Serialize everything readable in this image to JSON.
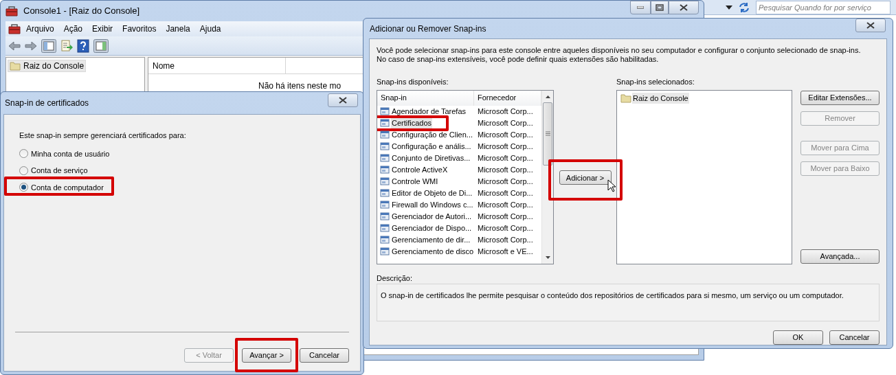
{
  "browser_bar": {
    "search": {
      "placeholder": "Pesquisar Quando for por serviço"
    }
  },
  "console": {
    "title": "Console1 - [Raiz do Console]",
    "menu": [
      "Arquivo",
      "Ação",
      "Exibir",
      "Favoritos",
      "Janela",
      "Ajuda"
    ],
    "tree": [
      {
        "label": "Raiz do Console",
        "selected": true
      }
    ],
    "list": {
      "columns": [
        "Nome"
      ],
      "empty_message": "Não há itens neste mo"
    }
  },
  "certificate_dialog": {
    "title": "Snap-in de certificados",
    "prompt": "Este snap-in sempre gerenciará certificados para:",
    "options": [
      {
        "label": "Minha conta de usuário",
        "selected": false,
        "highlighted": false
      },
      {
        "label": "Conta de serviço",
        "selected": false,
        "highlighted": false
      },
      {
        "label": "Conta de computador",
        "selected": true,
        "highlighted": true
      }
    ],
    "buttons": [
      {
        "label": "< Voltar",
        "disabled": true,
        "highlighted": false
      },
      {
        "label": "Avançar >",
        "disabled": false,
        "highlighted": true
      },
      {
        "label": "Cancelar",
        "disabled": false,
        "highlighted": false
      }
    ]
  },
  "snapin_dialog": {
    "title": "Adicionar ou Remover Snap-ins",
    "intro": [
      "Você pode selecionar snap-ins para este console entre aqueles disponíveis no seu computador e configurar o conjunto selecionado de snap-ins.",
      "No caso de snap-ins extensíveis, você pode definir quais extensões são habilitadas."
    ],
    "available_label": "Snap-ins disponíveis:",
    "columns": [
      "Snap-in",
      "Fornecedor"
    ],
    "available": [
      {
        "name": "Agendador de Tarefas",
        "vendor": "Microsoft Corp...",
        "selected": false,
        "highlighted": false
      },
      {
        "name": "Certificados",
        "vendor": "Microsoft Corp...",
        "selected": true,
        "highlighted": true
      },
      {
        "name": "Configuração de Clien...",
        "vendor": "Microsoft Corp...",
        "selected": false,
        "highlighted": false
      },
      {
        "name": "Configuração e anális...",
        "vendor": "Microsoft Corp...",
        "selected": false,
        "highlighted": false
      },
      {
        "name": "Conjunto de Diretivas...",
        "vendor": "Microsoft Corp...",
        "selected": false,
        "highlighted": false
      },
      {
        "name": "Controle ActiveX",
        "vendor": "Microsoft Corp...",
        "selected": false,
        "highlighted": false
      },
      {
        "name": "Controle WMI",
        "vendor": "Microsoft Corp...",
        "selected": false,
        "highlighted": false
      },
      {
        "name": "Editor de Objeto de Di...",
        "vendor": "Microsoft Corp...",
        "selected": false,
        "highlighted": false
      },
      {
        "name": "Firewall do Windows c...",
        "vendor": "Microsoft Corp...",
        "selected": false,
        "highlighted": false
      },
      {
        "name": "Gerenciador de Autori...",
        "vendor": "Microsoft Corp...",
        "selected": false,
        "highlighted": false
      },
      {
        "name": "Gerenciador de Dispo...",
        "vendor": "Microsoft Corp...",
        "selected": false,
        "highlighted": false
      },
      {
        "name": "Gerenciamento de dir...",
        "vendor": "Microsoft Corp...",
        "selected": false,
        "highlighted": false
      },
      {
        "name": "Gerenciamento de disco",
        "vendor": "Microsoft e VE...",
        "selected": false,
        "highlighted": false
      }
    ],
    "add_button": {
      "label": "Adicionar >",
      "highlighted": true
    },
    "selected_label": "Snap-ins selecionados:",
    "selected_items": [
      {
        "label": "Raiz do Console",
        "selected": true
      }
    ],
    "side_buttons": [
      {
        "label": "Editar Extensões...",
        "disabled": false
      },
      {
        "label": "Remover",
        "disabled": true
      },
      {
        "label": "Mover para Cima",
        "disabled": true
      },
      {
        "label": "Mover para Baixo",
        "disabled": true
      },
      {
        "label": "Avançada...",
        "disabled": false
      }
    ],
    "description_label": "Descrição:",
    "description": "O snap-in de certificados lhe permite pesquisar o conteúdo dos repositórios de certificados para si mesmo, um serviço ou um computador.",
    "buttons": [
      {
        "label": "OK",
        "disabled": false
      },
      {
        "label": "Cancelar",
        "disabled": false
      }
    ]
  }
}
